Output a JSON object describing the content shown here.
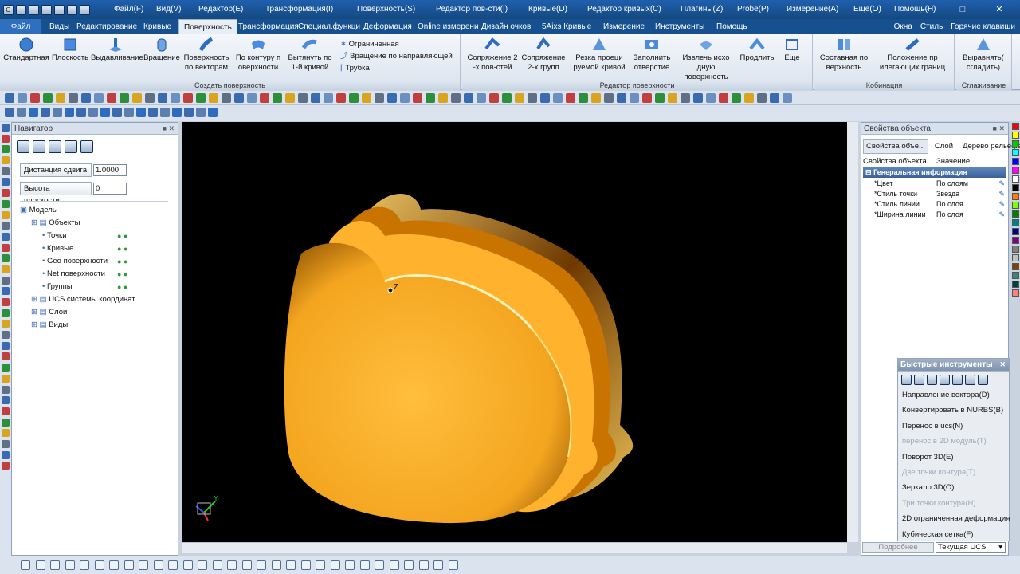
{
  "menus": [
    "Файл(F)",
    "Вид(V)",
    "Редактор(E)",
    "Трансформация(I)",
    "Поверхность(S)",
    "Редактор пов-сти(I)",
    "Кривые(D)",
    "Редактор кривых(C)",
    "Плагины(Z)",
    "Probe(P)",
    "Измерение(A)",
    "Еще(O)",
    "Помощь(H)"
  ],
  "file_button": "Файл",
  "tabs": [
    "Виды",
    "Редактирование",
    "Кривые",
    "Поверхность",
    "Трансформация",
    "Специал.функци",
    "Деформация",
    "Online измерени",
    "Дизайн очков",
    "5Aixs Кривые",
    "Измерение",
    "Инструменты",
    "Помощь"
  ],
  "tabs_right": {
    "window": "Окна",
    "style": "Стиль",
    "hotkeys": "Горячие клавиши"
  },
  "ribbon": {
    "create_surface": {
      "label": "Создать поверхность",
      "buttons": [
        {
          "label": "Стандартная",
          "label2": ""
        },
        {
          "label": "Плоскость",
          "label2": ""
        },
        {
          "label": "Выдавливание",
          "label2": ""
        },
        {
          "label": "Вращение",
          "label2": ""
        },
        {
          "label": "Поверхность",
          "label2": "по векторам"
        },
        {
          "label": "По контуру п",
          "label2": "оверхности"
        },
        {
          "label": "Вытянуть по",
          "label2": "1-й кривой"
        }
      ],
      "small": [
        "Ограниченная",
        "Вращение по направляющей",
        "Трубка"
      ]
    },
    "surface_editor": {
      "label": "Редактор поверхности",
      "buttons": [
        {
          "label": "Сопряжение 2",
          "label2": "-х пов-стей"
        },
        {
          "label": "Сопряжение",
          "label2": "2-х групп"
        },
        {
          "label": "Резка проеци",
          "label2": "руемой кривой"
        },
        {
          "label": "Заполнить",
          "label2": "отверстие"
        },
        {
          "label": "Извлечь исхо",
          "label2": "дную поверхность"
        },
        {
          "label": "Продлить",
          "label2": ""
        },
        {
          "label": "Еще",
          "label2": ""
        }
      ]
    },
    "combination": {
      "label": "Кобинация",
      "buttons": [
        {
          "label": "Составная по",
          "label2": "верхность"
        },
        {
          "label": "Положение пр",
          "label2": "илегающих границ"
        }
      ]
    },
    "smoothing": {
      "label": "Сглаживание",
      "buttons": [
        {
          "label": "Выравнять(",
          "label2": "сгладить)"
        }
      ]
    }
  },
  "navigator": {
    "title": "Навигатор",
    "shift_label": "Дистанция сдвига",
    "shift_value": "1.0000",
    "plane_label": "Высота плоскости",
    "plane_value": "0",
    "tree": [
      {
        "label": "Модель",
        "level": 0,
        "bulbs": false
      },
      {
        "label": "Объекты",
        "level": 1,
        "bulbs": false
      },
      {
        "label": "Точки",
        "level": 2,
        "bulbs": true
      },
      {
        "label": "Кривые",
        "level": 2,
        "bulbs": true
      },
      {
        "label": "Geo поверхности",
        "level": 2,
        "bulbs": true
      },
      {
        "label": "Net поверхности",
        "level": 2,
        "bulbs": true
      },
      {
        "label": "Группы",
        "level": 2,
        "bulbs": true
      },
      {
        "label": "UCS системы координат",
        "level": 1,
        "bulbs": false
      },
      {
        "label": "Слои",
        "level": 1,
        "bulbs": false
      },
      {
        "label": "Виды",
        "level": 1,
        "bulbs": false
      }
    ]
  },
  "viewport": {
    "axis_label": "Z",
    "triad_label": "Y"
  },
  "properties": {
    "title": "Свойства объекта",
    "tabs": [
      "Свойства объе...",
      "Слой",
      "Дерево рельефа"
    ],
    "col_prop": "Свойства объекта",
    "col_value": "Значение",
    "section": "Генеральная информация",
    "rows": [
      {
        "name": "*Цвет",
        "value": "По слоям"
      },
      {
        "name": "*Стиль точки",
        "value": "Звезда"
      },
      {
        "name": "*Стиль линии",
        "value": "По слоя"
      },
      {
        "name": "*Ширина линии",
        "value": "По слоя"
      }
    ]
  },
  "quick_tools": {
    "title": "Быстрые инструменты",
    "items": [
      {
        "label": "Направление вектора(D)",
        "disabled": false
      },
      {
        "label": "Конвертировать в NURBS(B)",
        "disabled": false
      },
      {
        "label": "Перенос в ucs(N)",
        "disabled": false
      },
      {
        "label": "перенос в 2D модуль(T)",
        "disabled": true
      },
      {
        "label": "Поворот 3D(E)",
        "disabled": false
      },
      {
        "label": "Две точки контура(T)",
        "disabled": true
      },
      {
        "label": "Зеркало 3D(O)",
        "disabled": false
      },
      {
        "label": "Три точки контура(H)",
        "disabled": true
      },
      {
        "label": "2D ограниченная деформация",
        "disabled": false
      },
      {
        "label": "Кубическая сетка(F)",
        "disabled": false
      }
    ],
    "more": "Подробнее",
    "ucs": "Текущая UCS"
  },
  "colors": {
    "accent": "#1a5aa3",
    "surface": "#f5a623",
    "palette": [
      "#ff0000",
      "#ffff00",
      "#00cc00",
      "#00ffff",
      "#0000ff",
      "#ff00ff",
      "#ffffff",
      "#000000",
      "#ff8000",
      "#80ff00",
      "#008000",
      "#008080",
      "#000080",
      "#800080",
      "#808080",
      "#c0c0c0",
      "#804000",
      "#408080",
      "#004040",
      "#ff8080"
    ]
  }
}
